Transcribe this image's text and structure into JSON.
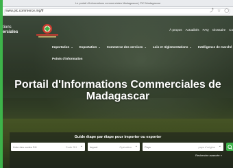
{
  "browser": {
    "tab_title": "Le portail d'informations commerciales Madagascar | PIC Madagascar",
    "url": "www.pic.commerce.mg/fr"
  },
  "brand": {
    "line1": "tions",
    "line2": "erciales"
  },
  "top_nav": [
    "À propos",
    "Actualités",
    "FAQ",
    "Glossaire",
    "Co"
  ],
  "main_nav": [
    {
      "label": "Importation"
    },
    {
      "label": "Exportation"
    },
    {
      "label": "Commerce des services"
    },
    {
      "label": "Lois et réglementations"
    },
    {
      "label": "Intelligence de marché"
    }
  ],
  "sub_nav": "Points d'information",
  "hero": {
    "title": "Portail d'Informations Commerciales de Madagascar"
  },
  "search": {
    "guide_text": "Guide étape par étape pour importer ou exporter",
    "fields": [
      {
        "placeholder": "Liste des codes SH",
        "selected": "Code SH"
      },
      {
        "placeholder": "Import",
        "selected": "Opération"
      },
      {
        "placeholder": "Pays",
        "selected": "pays d'origine"
      }
    ],
    "advanced_link": "Recherche avancée »"
  },
  "colors": {
    "accent": "#3db34a"
  }
}
